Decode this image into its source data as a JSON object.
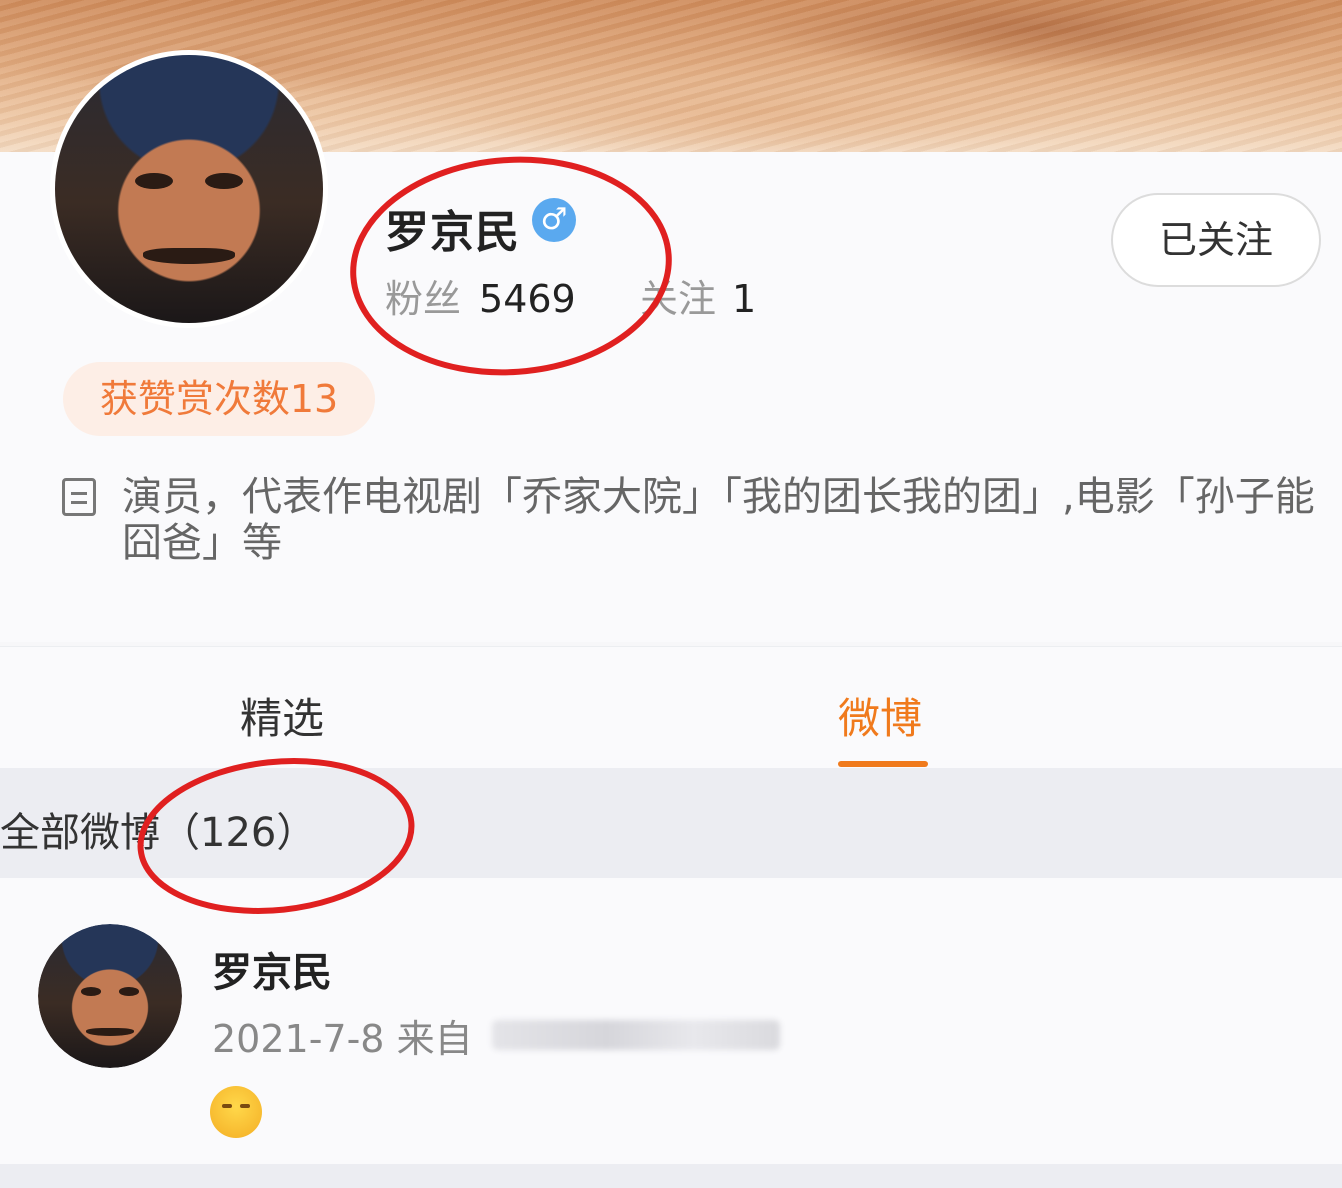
{
  "profile": {
    "name": "罗京民",
    "gender_icon": "male-icon",
    "gender_symbol": "♂",
    "fans_label": "粉丝",
    "fans_count": "5469",
    "following_label": "关注",
    "following_count": "1",
    "follow_button": "已关注",
    "reward_badge": "获赞赏次数13",
    "bio": "演员，代表作电视剧「乔家大院」「我的团长我的团」,电影「孙子能囧爸」等"
  },
  "tabs": [
    {
      "label": "精选",
      "active": false
    },
    {
      "label": "微博",
      "active": true
    }
  ],
  "filter": {
    "label": "全部微博（126）"
  },
  "post": {
    "author": "罗京民",
    "date": "2021-7-8",
    "source_prefix": "来自",
    "emoji_icon": "blushing-face-icon"
  },
  "colors": {
    "accent": "#f07a1c",
    "reward_text": "#f07a3a",
    "gender_badge": "#5aa9ef",
    "annotation": "#e02020"
  }
}
